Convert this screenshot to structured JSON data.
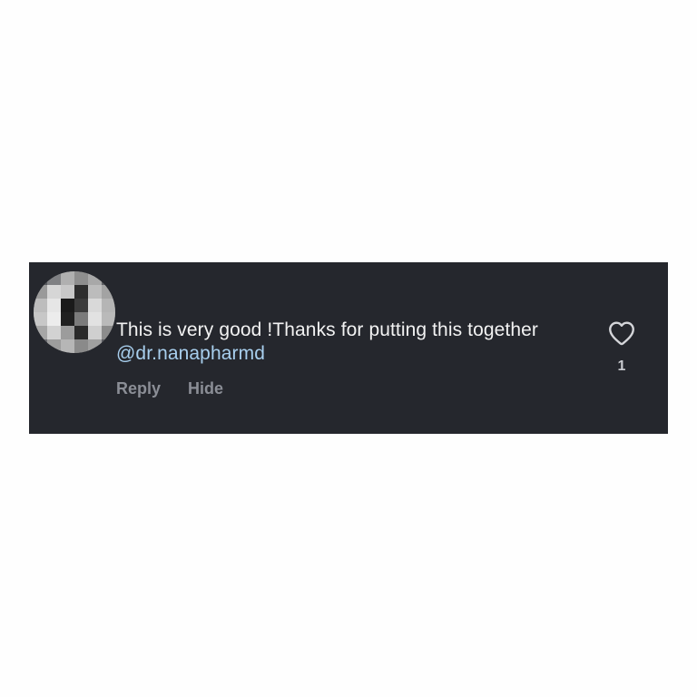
{
  "comment": {
    "text_main": "This is very good !Thanks for putting this together ",
    "mention": "@dr.nanapharmd",
    "avatar_icon": "pixelated-avatar",
    "colors": {
      "card_background": "#25272d",
      "text": "#f2f2f2",
      "mention": "#a8cfee",
      "action": "#8b8e96"
    }
  },
  "actions": {
    "reply_label": "Reply",
    "hide_label": "Hide"
  },
  "like": {
    "icon": "heart-outline-icon",
    "count": "1"
  }
}
